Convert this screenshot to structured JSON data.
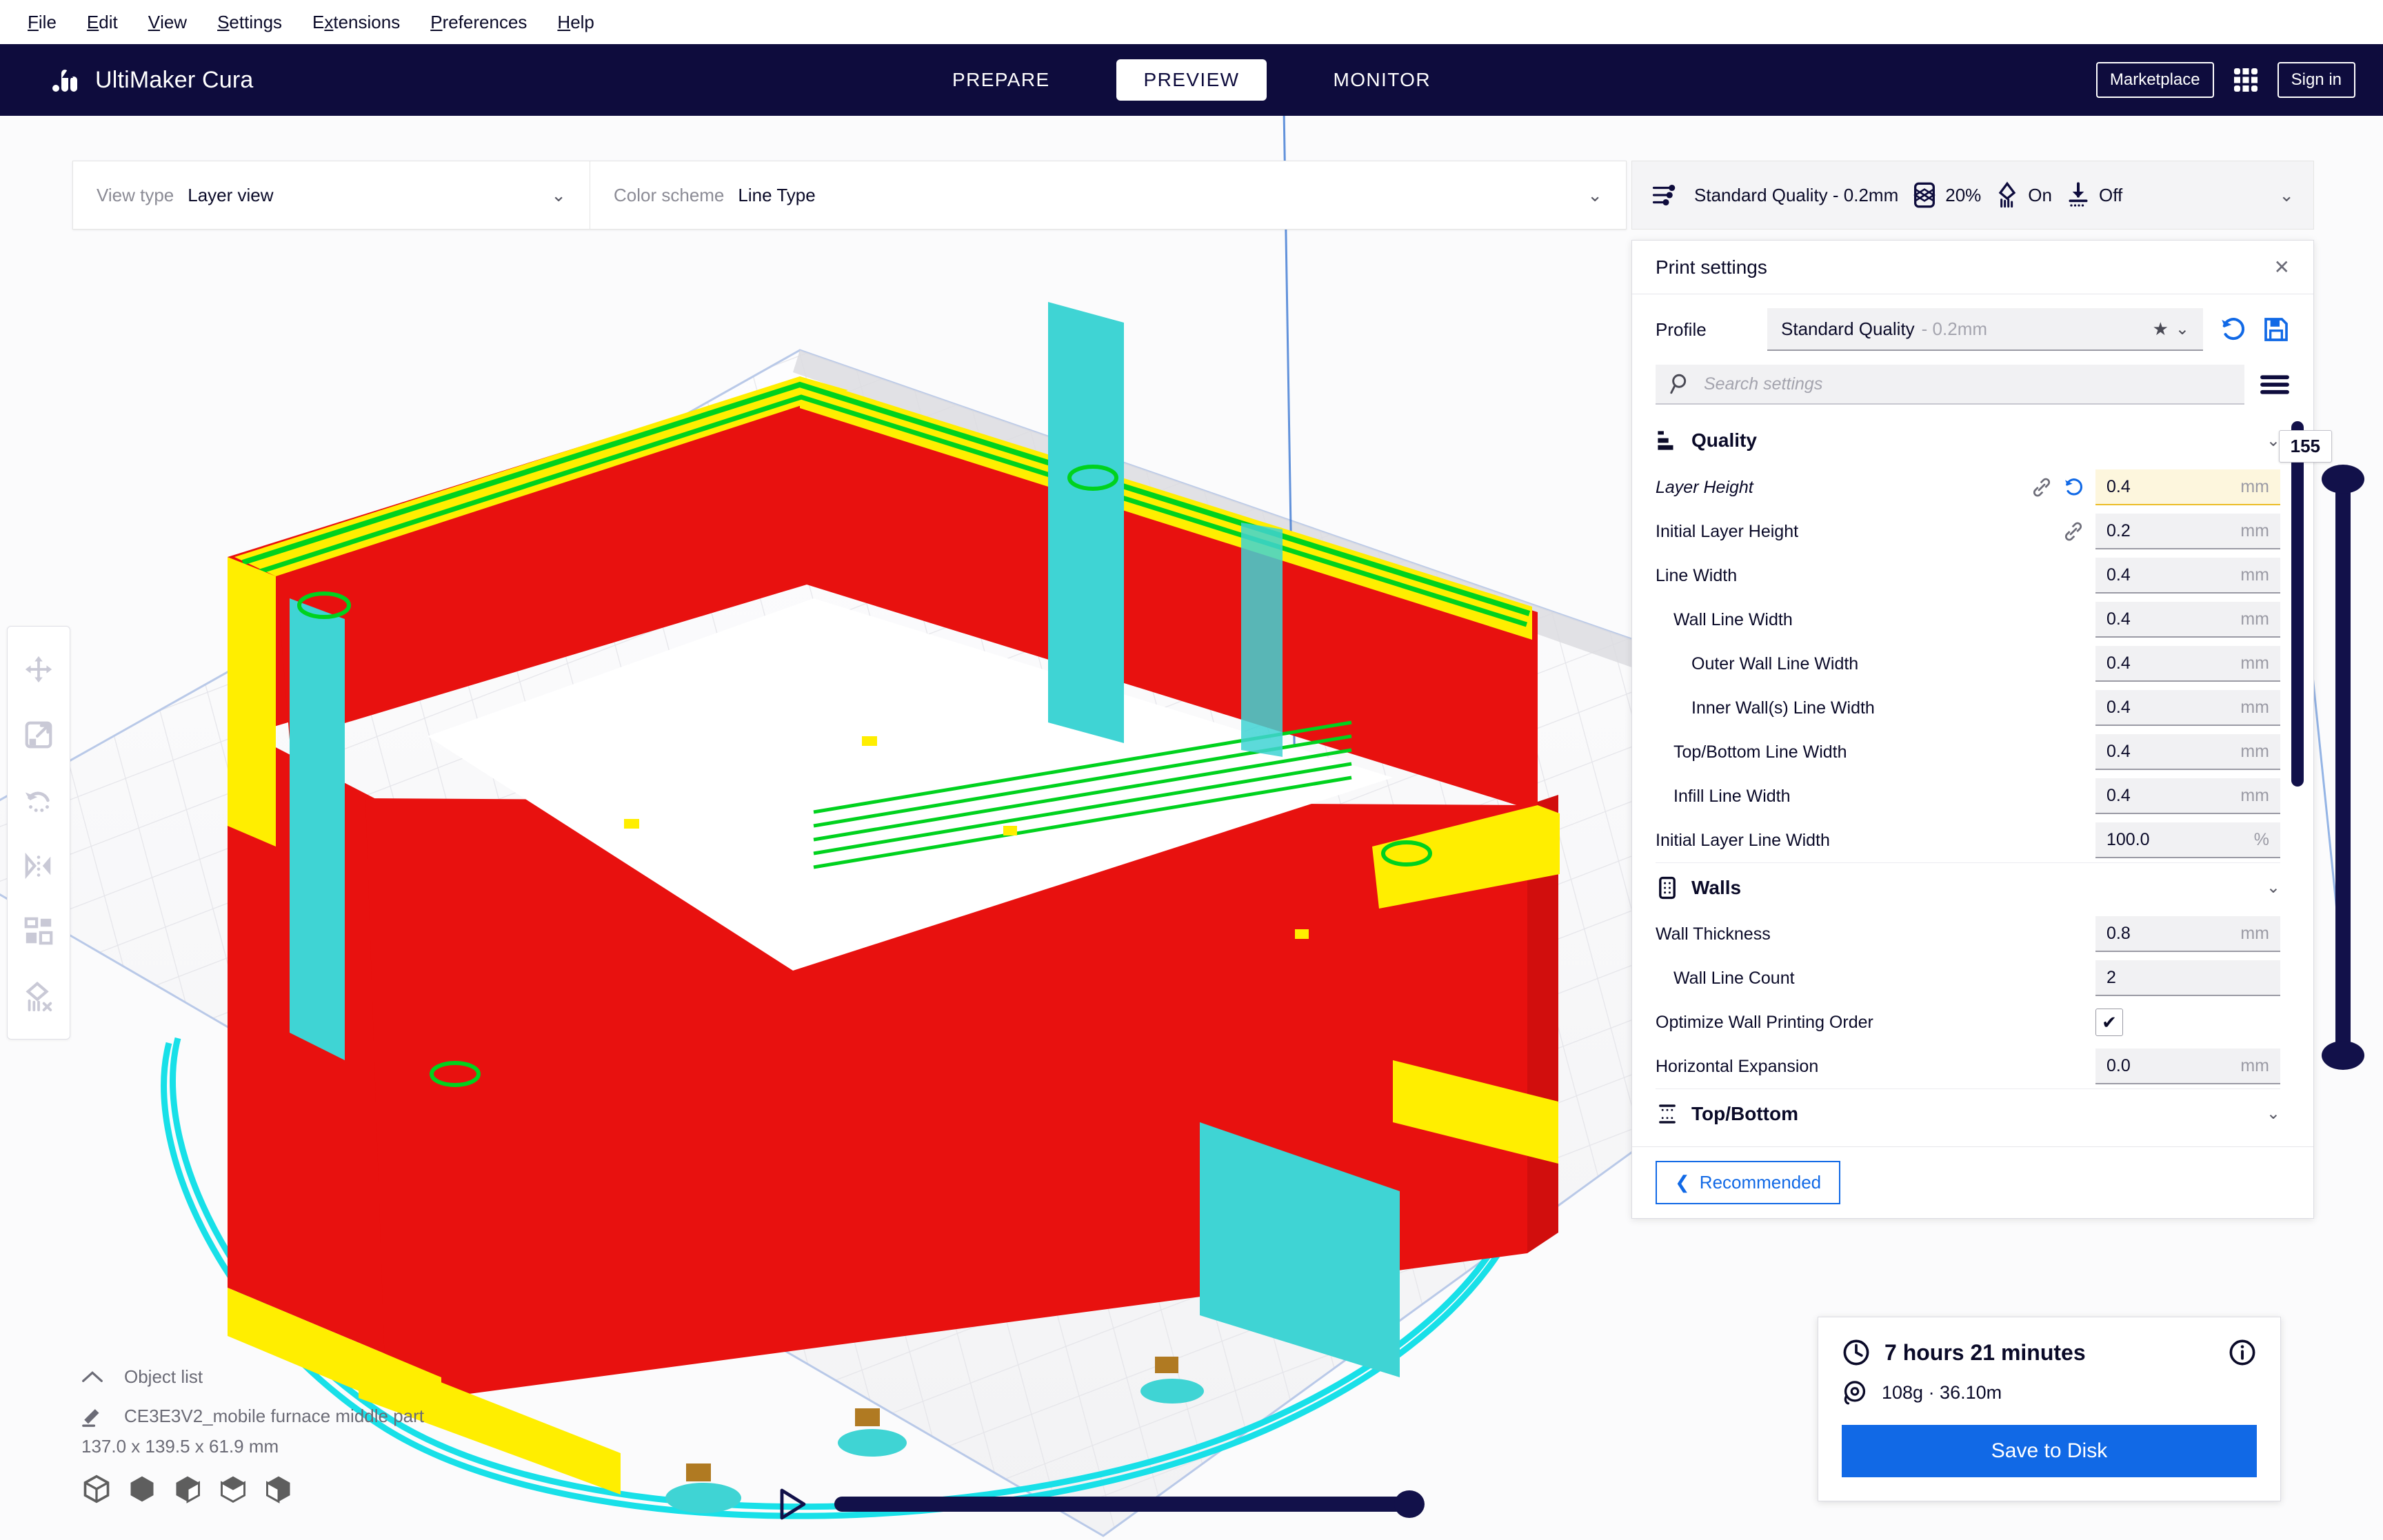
{
  "menubar": {
    "items": [
      {
        "pre": "",
        "key": "F",
        "post": "ile"
      },
      {
        "pre": "",
        "key": "E",
        "post": "dit"
      },
      {
        "pre": "",
        "key": "V",
        "post": "iew"
      },
      {
        "pre": "",
        "key": "S",
        "post": "ettings"
      },
      {
        "pre": "E",
        "key": "x",
        "post": "tensions"
      },
      {
        "pre": "",
        "key": "P",
        "post": "references"
      },
      {
        "pre": "",
        "key": "H",
        "post": "elp"
      }
    ]
  },
  "topbar": {
    "brand": "UltiMaker Cura",
    "brand_logo_icon": "ultimaker-logo-icon",
    "tabs": [
      {
        "label": "PREPARE",
        "active": false
      },
      {
        "label": "PREVIEW",
        "active": true
      },
      {
        "label": "MONITOR",
        "active": false
      }
    ],
    "marketplace_label": "Marketplace",
    "apps_icon": "apps-grid-icon",
    "signin_label": "Sign in"
  },
  "viewtype": {
    "view_type_label": "View type",
    "view_type_value": "Layer view",
    "color_scheme_label": "Color scheme",
    "color_scheme_value": "Line Type",
    "chevron_icon": "chevron-down-icon"
  },
  "summary": {
    "profile_icon": "print-settings-sliders-icon",
    "profile_text": "Standard Quality - 0.2mm",
    "infill_icon": "infill-icon",
    "infill_value": "20%",
    "support_icon": "support-icon",
    "support_value": "On",
    "adhesion_icon": "adhesion-icon",
    "adhesion_value": "Off",
    "chevron_icon": "chevron-down-icon"
  },
  "print_settings": {
    "title": "Print settings",
    "close_icon": "close-icon",
    "profile_label": "Profile",
    "profile_name": "Standard Quality",
    "profile_sub": "- 0.2mm",
    "star_icon": "star-icon",
    "chevron_icon": "chevron-down-icon",
    "revert_icon": "revert-arrow-icon",
    "save_icon": "save-disk-icon",
    "search_placeholder": "Search settings",
    "search_value": "",
    "search_icon": "search-icon",
    "menu_icon": "hamburger-menu-icon",
    "categories": [
      {
        "name": "Quality",
        "icon": "quality-icon",
        "chevron": "chevron-down-icon",
        "settings": [
          {
            "label": "Layer Height",
            "value": "0.4",
            "unit": "mm",
            "indent": 0,
            "modified": true,
            "link": true,
            "revert": true,
            "type": "text"
          },
          {
            "label": "Initial Layer Height",
            "value": "0.2",
            "unit": "mm",
            "indent": 0,
            "modified": false,
            "link": true,
            "revert": false,
            "type": "text"
          },
          {
            "label": "Line Width",
            "value": "0.4",
            "unit": "mm",
            "indent": 0,
            "modified": false,
            "link": false,
            "revert": false,
            "type": "text"
          },
          {
            "label": "Wall Line Width",
            "value": "0.4",
            "unit": "mm",
            "indent": 1,
            "modified": false,
            "link": false,
            "revert": false,
            "type": "text"
          },
          {
            "label": "Outer Wall Line Width",
            "value": "0.4",
            "unit": "mm",
            "indent": 2,
            "modified": false,
            "link": false,
            "revert": false,
            "type": "text"
          },
          {
            "label": "Inner Wall(s) Line Width",
            "value": "0.4",
            "unit": "mm",
            "indent": 2,
            "modified": false,
            "link": false,
            "revert": false,
            "type": "text"
          },
          {
            "label": "Top/Bottom Line Width",
            "value": "0.4",
            "unit": "mm",
            "indent": 1,
            "modified": false,
            "link": false,
            "revert": false,
            "type": "text"
          },
          {
            "label": "Infill Line Width",
            "value": "0.4",
            "unit": "mm",
            "indent": 1,
            "modified": false,
            "link": false,
            "revert": false,
            "type": "text"
          },
          {
            "label": "Initial Layer Line Width",
            "value": "100.0",
            "unit": "%",
            "indent": 0,
            "modified": false,
            "link": false,
            "revert": false,
            "type": "text"
          }
        ]
      },
      {
        "name": "Walls",
        "icon": "walls-icon",
        "chevron": "chevron-down-icon",
        "settings": [
          {
            "label": "Wall Thickness",
            "value": "0.8",
            "unit": "mm",
            "indent": 0,
            "modified": false,
            "link": false,
            "revert": false,
            "type": "text"
          },
          {
            "label": "Wall Line Count",
            "value": "2",
            "unit": "",
            "indent": 1,
            "modified": false,
            "link": false,
            "revert": false,
            "type": "text"
          },
          {
            "label": "Optimize Wall Printing Order",
            "value": "✔",
            "unit": "",
            "indent": 0,
            "modified": false,
            "link": false,
            "revert": false,
            "type": "checkbox"
          },
          {
            "label": "Horizontal Expansion",
            "value": "0.0",
            "unit": "mm",
            "indent": 0,
            "modified": false,
            "link": false,
            "revert": false,
            "type": "text"
          }
        ]
      },
      {
        "name": "Top/Bottom",
        "icon": "topbottom-icon",
        "chevron": "chevron-down-icon",
        "settings": []
      }
    ],
    "recommended_label": "Recommended",
    "recommended_chevron_icon": "chevron-left-icon"
  },
  "left_toolbar": {
    "tools": [
      {
        "name": "move-tool",
        "icon": "move-icon"
      },
      {
        "name": "scale-tool",
        "icon": "scale-icon"
      },
      {
        "name": "rotate-tool",
        "icon": "rotate-icon"
      },
      {
        "name": "mirror-tool",
        "icon": "mirror-icon"
      },
      {
        "name": "per-model-settings-tool",
        "icon": "per-model-settings-icon"
      },
      {
        "name": "support-blocker-tool",
        "icon": "support-blocker-icon"
      }
    ]
  },
  "object_list": {
    "header": "Object list",
    "collapse_icon": "chevron-up-icon",
    "edit_icon": "pencil-icon",
    "object_name": "CE3E3V2_mobile furnace middle part",
    "dimensions": "137.0 x 139.5 x 61.9 mm",
    "view_icons": [
      "cube-outline-icon",
      "cube-solid-icon",
      "cube-left-icon",
      "cube-top-icon",
      "cube-right-icon"
    ]
  },
  "playback": {
    "play_icon": "play-icon",
    "position_percent": 100
  },
  "layer_slider": {
    "value": "155",
    "max": 155,
    "handle_top_icon": "slider-handle-top",
    "handle_bottom_icon": "slider-handle-bottom"
  },
  "print_info": {
    "time_icon": "clock-icon",
    "time": "7 hours 21 minutes",
    "info_icon": "info-icon",
    "material_icon": "filament-spool-icon",
    "material": "108g · 36.10m",
    "save_label": "Save to Disk"
  },
  "colors": {
    "navy": "#0e0c3d",
    "accent_blue": "#1169e6",
    "wall_red": "#e8110f",
    "top_bottom_yellow": "#ffee00",
    "inner_wall_green": "#00d21e",
    "support_cyan": "#3fd4d4",
    "skirt_cyan": "#18e0e8",
    "highlight_yellow": "#fdf6dd"
  }
}
